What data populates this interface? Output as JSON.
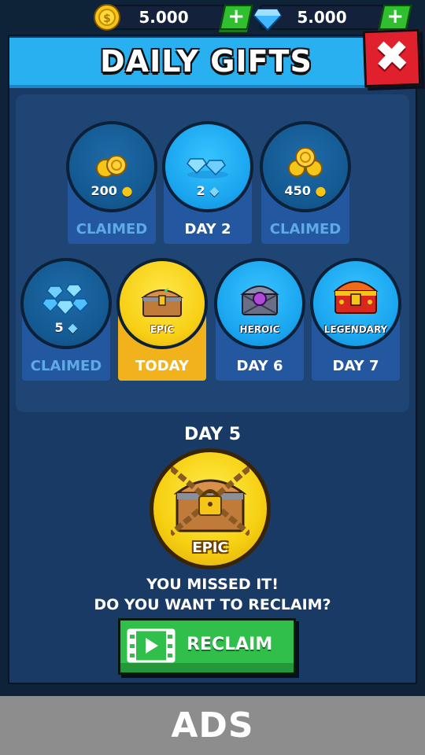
{
  "top_bar": {
    "coins": {
      "amount": "5.000",
      "icon": "coin-icon"
    },
    "gems": {
      "amount": "5.000",
      "icon": "gem-icon"
    },
    "plus_label": "+"
  },
  "panel": {
    "title": "DAILY GIFTS",
    "close_label": "✖"
  },
  "days": [
    {
      "label": "CLAIMED",
      "reward": "200",
      "reward_icon": "coin-icon",
      "state": "claimed"
    },
    {
      "label": "DAY 2",
      "reward": "2",
      "reward_icon": "gem-icon",
      "state": "upcoming"
    },
    {
      "label": "CLAIMED",
      "reward": "450",
      "reward_icon": "coin-icon",
      "state": "claimed"
    },
    {
      "label": "CLAIMED",
      "reward": "5",
      "reward_icon": "gem-icon",
      "state": "claimed"
    },
    {
      "label": "TODAY",
      "reward": "EPIC",
      "reward_icon": "epic-chest-icon",
      "state": "today"
    },
    {
      "label": "DAY 6",
      "reward": "HEROIC",
      "reward_icon": "heroic-chest-icon",
      "state": "upcoming"
    },
    {
      "label": "DAY 7",
      "reward": "LEGENDARY",
      "reward_icon": "legendary-chest-icon",
      "state": "upcoming"
    }
  ],
  "missed": {
    "day_label": "DAY 5",
    "chest_tier": "EPIC",
    "chest_icon": "locked-chest-icon",
    "line1": "YOU MISSED IT!",
    "line2": "DO YOU WANT TO RECLAIM?",
    "button_label": "RECLAIM",
    "button_icon": "video-play-icon"
  },
  "ad_banner": {
    "label": "ADS"
  },
  "colors": {
    "panel_bg": "#1a3a66",
    "header_blue": "#29b0f0",
    "close_red": "#e0202c",
    "today_gold": "#f2b21c",
    "button_green": "#2fbf4a",
    "claimed_text": "#5fa9e6"
  }
}
